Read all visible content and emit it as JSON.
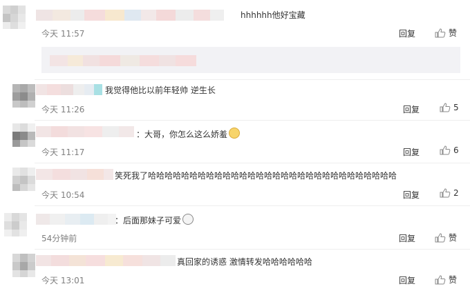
{
  "comments": [
    {
      "text": "hhhhhh他好宝藏",
      "time": "今天 11:57",
      "reply_label": "回复",
      "like_label": "赞",
      "like_count": ""
    },
    {
      "text": "我觉得他比以前年轻帅 逆生长",
      "time": "今天 11:26",
      "reply_label": "回复",
      "like_count": "5"
    },
    {
      "text": "：大哥，你怎么这么娇羞",
      "time": "今天 11:17",
      "reply_label": "回复",
      "like_count": "6"
    },
    {
      "text": "笑死我了哈哈哈哈哈哈哈哈哈哈哈哈哈哈哈哈哈哈哈哈哈哈哈哈哈哈哈哈哈哈",
      "time": "今天 10:54",
      "reply_label": "回复",
      "like_count": "2"
    },
    {
      "text": "：后面那妹子可爱",
      "time": "54分钟前",
      "reply_label": "回复",
      "like_label": "赞",
      "like_count": ""
    },
    {
      "text": "真回家的诱惑 激情转发哈哈哈哈哈哈",
      "time": "今天 13:01",
      "reply_label": "回复",
      "like_label": "赞",
      "like_count": ""
    }
  ],
  "colors": {
    "text": "#333333",
    "time": "#808080",
    "divider": "#eeeeee",
    "subbox": "#f2f2f5"
  },
  "icons": {
    "like": "thumbs-up-icon",
    "emoji_shy": "shy-cat-emoji-icon",
    "emoji_smile": "smile-emoji-icon"
  }
}
